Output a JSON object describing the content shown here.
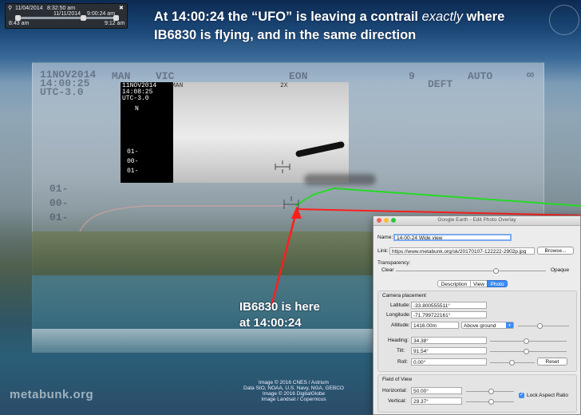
{
  "toolbar": {
    "date_left": "11/04/2014",
    "time_left": "8:32:50 am",
    "date_mid": "11/11/2014",
    "time_mid": "9:00:24 am",
    "start_time": "8:43 am",
    "end_time": "9:12 am"
  },
  "headline": {
    "line1_prefix": "At 14:00:24 the “UFO” is leaving a contrail ",
    "line1_em": "exactly",
    "line1_suffix": " where",
    "line2": "IB6830 is flying, and in the same direction"
  },
  "hud": {
    "date": "11NOV2014",
    "time": "14:00:25",
    "utc": "UTC-3.0",
    "man": "MAN",
    "vic": "VIC",
    "eon": "EON",
    "nine": "9",
    "auto": "AUTO",
    "defl": "DEFT",
    "inf": "∞",
    "ticks": [
      "01-",
      "00-",
      "01-"
    ]
  },
  "inset": {
    "date": "11NOV2014",
    "time": "14:08:25",
    "utc": "UTC-3.0",
    "man": "MAN",
    "tag": "2X",
    "north": "N",
    "ticks": [
      "01-",
      "00-",
      "01-"
    ]
  },
  "annotation": {
    "line1": "IB6830 is here",
    "line2": "at 14:00:24"
  },
  "credits": [
    "Image © 2016 CNES / Astrium",
    "Data SIO, NOAA, U.S. Navy, NGA, GEBCO",
    "Image © 2016 DigitalGlobe",
    "Image Landsat / Copernicus"
  ],
  "watermark": "metabunk.org",
  "dialog": {
    "title": "Google Earth - Edit Photo Overlay",
    "name_label": "Name:",
    "name_value": "14-00-24 Wide view",
    "link_label": "Link:",
    "link_value": "https://www.metabunk.org/sk/20170107-122222-2902p.jpg",
    "browse": "Browse...",
    "transparency_label": "Transparency:",
    "clear": "Clear",
    "opaque": "Opaque",
    "tabs": [
      "Description",
      "View",
      "Photo"
    ],
    "active_tab": "Photo",
    "camera_section": "Camera placement",
    "latitude_label": "Latitude:",
    "latitude": "-33.800555511°",
    "longitude_label": "Longitude:",
    "longitude": "-71.799722161°",
    "altitude_label": "Altitude:",
    "altitude": "1416.00m",
    "altitude_mode": "Above ground",
    "heading_label": "Heading:",
    "heading": "34.38°",
    "tilt_label": "Tilt:",
    "tilt": "91.54°",
    "roll_label": "Roll:",
    "roll": "0.00°",
    "reset": "Reset",
    "fov_section": "Field of View",
    "horizontal_label": "Horizontal:",
    "horizontal": "50.00°",
    "vertical_label": "Vertical:",
    "vertical": "29.37°",
    "lock_label": "Lock Aspect Ratio",
    "lock_checked": true
  },
  "colors": {
    "green_line": "#26d926",
    "red_line": "#ff1f1f",
    "accent": "#3b8cf5"
  }
}
